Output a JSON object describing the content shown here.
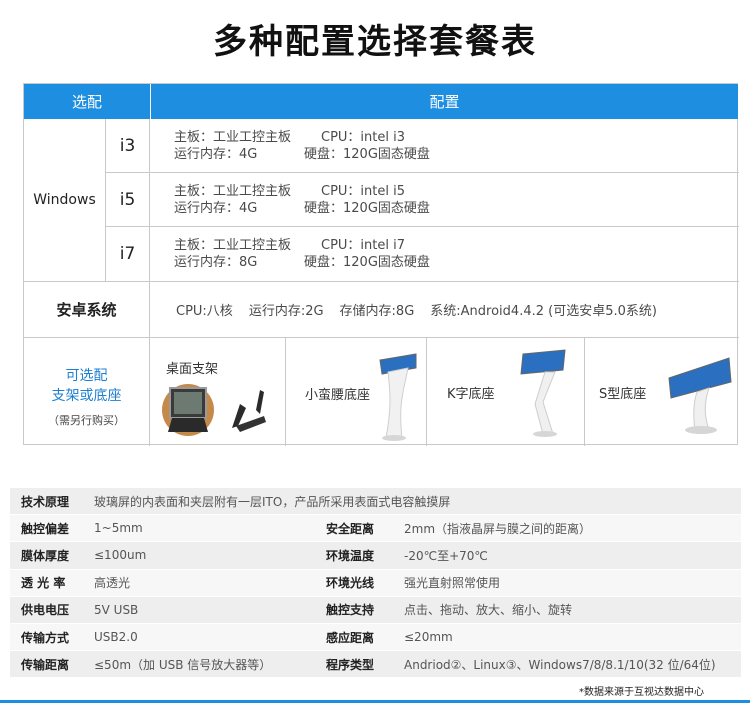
{
  "title": "多种配置选择套餐表",
  "config_table": {
    "header": {
      "left": "选配",
      "right": "配置"
    },
    "os": "Windows",
    "rows": [
      {
        "cpu": "i3",
        "board": "主板：工业工控主板",
        "cpu_spec": "CPU：intel i3",
        "ram": "运行内存：4G",
        "disk": "硬盘：120G固态硬盘"
      },
      {
        "cpu": "i5",
        "board": "主板：工业工控主板",
        "cpu_spec": "CPU：intel i5",
        "ram": "运行内存：4G",
        "disk": "硬盘：120G固态硬盘"
      },
      {
        "cpu": "i7",
        "board": "主板：工业工控主板",
        "cpu_spec": "CPU：intel i7",
        "ram": "运行内存：8G",
        "disk": "硬盘：120G固态硬盘"
      }
    ],
    "android": {
      "label": "安卓系统",
      "cpu": "CPU:八核",
      "ram": "运行内存:2G",
      "storage": "存储内存:8G",
      "system": "系统:Android4.4.2 (可选安卓5.0系统)"
    },
    "options": {
      "label_line1": "可选配",
      "label_line2": "支架或底座",
      "note": "（需另行购买）",
      "items": [
        "桌面支架",
        "小蛮腰底座",
        "K字底座",
        "S型底座"
      ]
    }
  },
  "spec_table": {
    "full_row": {
      "key": "技术原理",
      "value": "玻璃屏的内表面和夹层附有一层ITO，产品所采用表面式电容触摸屏"
    },
    "rows": [
      {
        "k1": "触控偏差",
        "v1": "1~5mm",
        "k2": "安全距离",
        "v2": "2mm（指液晶屏与膜之间的距离）"
      },
      {
        "k1": "膜体厚度",
        "v1": "≤100um",
        "k2": "环境温度",
        "v2": "-20℃至+70℃"
      },
      {
        "k1": "透 光 率",
        "v1": "高透光",
        "k2": "环境光线",
        "v2": "强光直射照常使用"
      },
      {
        "k1": "供电电压",
        "v1": "5V USB",
        "k2": "触控支持",
        "v2": "点击、拖动、放大、缩小、旋转"
      },
      {
        "k1": "传输方式",
        "v1": "USB2.0",
        "k2": "感应距离",
        "v2": "≤20mm"
      },
      {
        "k1": "传输距离",
        "v1": "≤50m（加 USB 信号放大器等）",
        "k2": "程序类型",
        "v2": "Andriod②、Linux③、Windows7/8/8.1/10(32 位/64位)"
      }
    ]
  },
  "footnote": "*数据来源于互视达数据中心",
  "colors": {
    "accent": "#1d8ee0",
    "option_text": "#1d7fd0"
  }
}
